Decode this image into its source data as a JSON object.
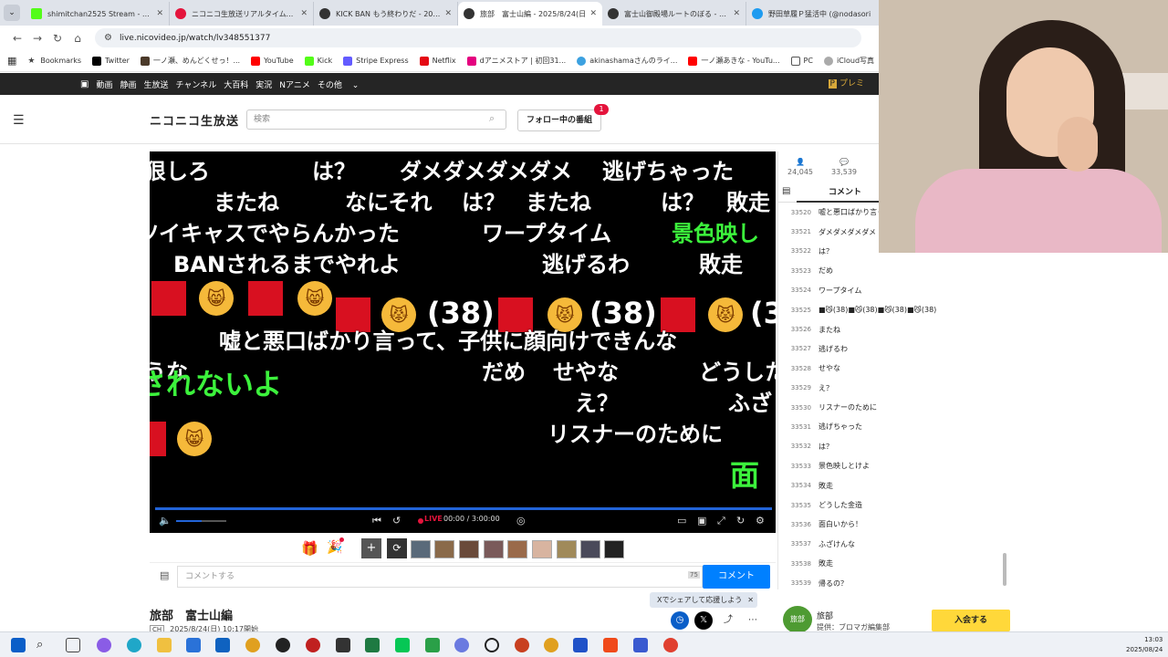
{
  "browser": {
    "tabs": [
      {
        "title": "shimitchan2525 Stream - Watc",
        "color": "#53fc18"
      },
      {
        "title": "ニコニコ生放送リアルタイムランキング",
        "color": "#e4143c"
      },
      {
        "title": "KICK BAN もう終わりだ - 2025/8/",
        "color": "#333333"
      },
      {
        "title": "旅部　富士山編 - 2025/8/24(日",
        "color": "#333333"
      },
      {
        "title": "富士山御殿場ルートのぼる - 2025",
        "color": "#333333"
      },
      {
        "title": "野田草履Ｐ猛活中 (@nodasori",
        "color": "#1d9bf0"
      }
    ],
    "url": "live.nicovideo.jp/watch/lv348551377",
    "bookmarks": [
      "Bookmarks",
      "Twitter",
      "一ノ瀬、めんどくせっ！...",
      "YouTube",
      "Kick",
      "Stripe Express",
      "Netflix",
      "dアニメストア | 初回31...",
      "akinashamaさんのライ...",
      "一ノ瀬あきな - YouTu...",
      "PC",
      "iCloud写真",
      "コス",
      "刑事"
    ]
  },
  "nico": {
    "topnav": [
      "動画",
      "静画",
      "生放送",
      "チャンネル",
      "大百科",
      "実況",
      "Nアニメ",
      "その他"
    ],
    "premium": "プレミ",
    "logo": "ニコニコ生放送",
    "search_placeholder": "検索",
    "follow_label": "フォロー中の番組",
    "follow_badge": "1"
  },
  "player": {
    "overlay_comments": [
      {
        "text": "狠しろ",
        "green": false
      },
      {
        "text": "は？",
        "green": false
      },
      {
        "text": "ダメダメダメダメ",
        "green": false
      },
      {
        "text": "逃げちゃった",
        "green": false
      },
      {
        "text": "またね",
        "green": false
      },
      {
        "text": "なにそれ",
        "green": false
      },
      {
        "text": "は？",
        "green": false
      },
      {
        "text": "またね",
        "green": false
      },
      {
        "text": "は？",
        "green": false
      },
      {
        "text": "敗走",
        "green": false
      },
      {
        "text": "ツイキャスでやらんかった",
        "green": false
      },
      {
        "text": "ワープタイム",
        "green": false
      },
      {
        "text": "景色映し",
        "green": true
      },
      {
        "text": "BANされるまでやれよ",
        "green": false
      },
      {
        "text": "逃げるわ",
        "green": false
      },
      {
        "text": "敗走",
        "green": false
      },
      {
        "text": "(38)",
        "green": false
      },
      {
        "text": "(38)",
        "green": false
      },
      {
        "text": "(3",
        "green": false
      },
      {
        "text": "嘘と悪口ばかり言って、子供に顔向けできんな",
        "green": false
      },
      {
        "text": "うな",
        "green": false
      },
      {
        "text": "されないよ",
        "green": true
      },
      {
        "text": "だめ",
        "green": false
      },
      {
        "text": "せやな",
        "green": false
      },
      {
        "text": "どうした",
        "green": false
      },
      {
        "text": "え？",
        "green": false
      },
      {
        "text": "ふざ",
        "green": false
      },
      {
        "text": "リスナーのために",
        "green": false
      },
      {
        "text": "面",
        "green": true
      }
    ],
    "progress": 1.0,
    "volume": 0.5,
    "live_label": "LIVE",
    "time": "00:00 / 3:00:00"
  },
  "comment_box": {
    "placeholder": "コメントする",
    "count": "75",
    "submit": "コメント"
  },
  "gift_badge_color": "#e4143c",
  "program": {
    "title": "旅部　富士山編",
    "ch_badge": "CH",
    "date": "2025/8/24(日) 10:17開始",
    "share_popup": "Xでシェアして応援しよう",
    "channel_name": "旅部",
    "channel_sub": "提供：ブロマガ編集部",
    "channel_logo": "旅部",
    "join": "入会する"
  },
  "panel": {
    "viewers": "24,045",
    "comments_total": "33,539",
    "tab": "コメント",
    "comments": [
      {
        "no": "33520",
        "text": "嘘と悪口ばかり言っ"
      },
      {
        "no": "33521",
        "text": "ダメダメダメダメ"
      },
      {
        "no": "33522",
        "text": "は？"
      },
      {
        "no": "33523",
        "text": "だめ"
      },
      {
        "no": "33524",
        "text": "ワープタイム"
      },
      {
        "no": "33525",
        "text": "■😼(38)■😼(38)■😼(38)■😼(38)"
      },
      {
        "no": "33526",
        "text": "またね"
      },
      {
        "no": "33527",
        "text": "逃げるわ"
      },
      {
        "no": "33528",
        "text": "せやな"
      },
      {
        "no": "33529",
        "text": "え？"
      },
      {
        "no": "33530",
        "text": "リスナーのために"
      },
      {
        "no": "33531",
        "text": "逃げちゃった"
      },
      {
        "no": "33532",
        "text": "は？"
      },
      {
        "no": "33533",
        "text": "景色映しとけよ"
      },
      {
        "no": "33534",
        "text": "敗走"
      },
      {
        "no": "33535",
        "text": "どうした金造"
      },
      {
        "no": "33536",
        "text": "面白いから！"
      },
      {
        "no": "33537",
        "text": "ふざけんな"
      },
      {
        "no": "33538",
        "text": "敗走"
      },
      {
        "no": "33539",
        "text": "帰るの？"
      }
    ]
  },
  "taskbar": {
    "time": "13:03",
    "date": "2025/08/24"
  }
}
